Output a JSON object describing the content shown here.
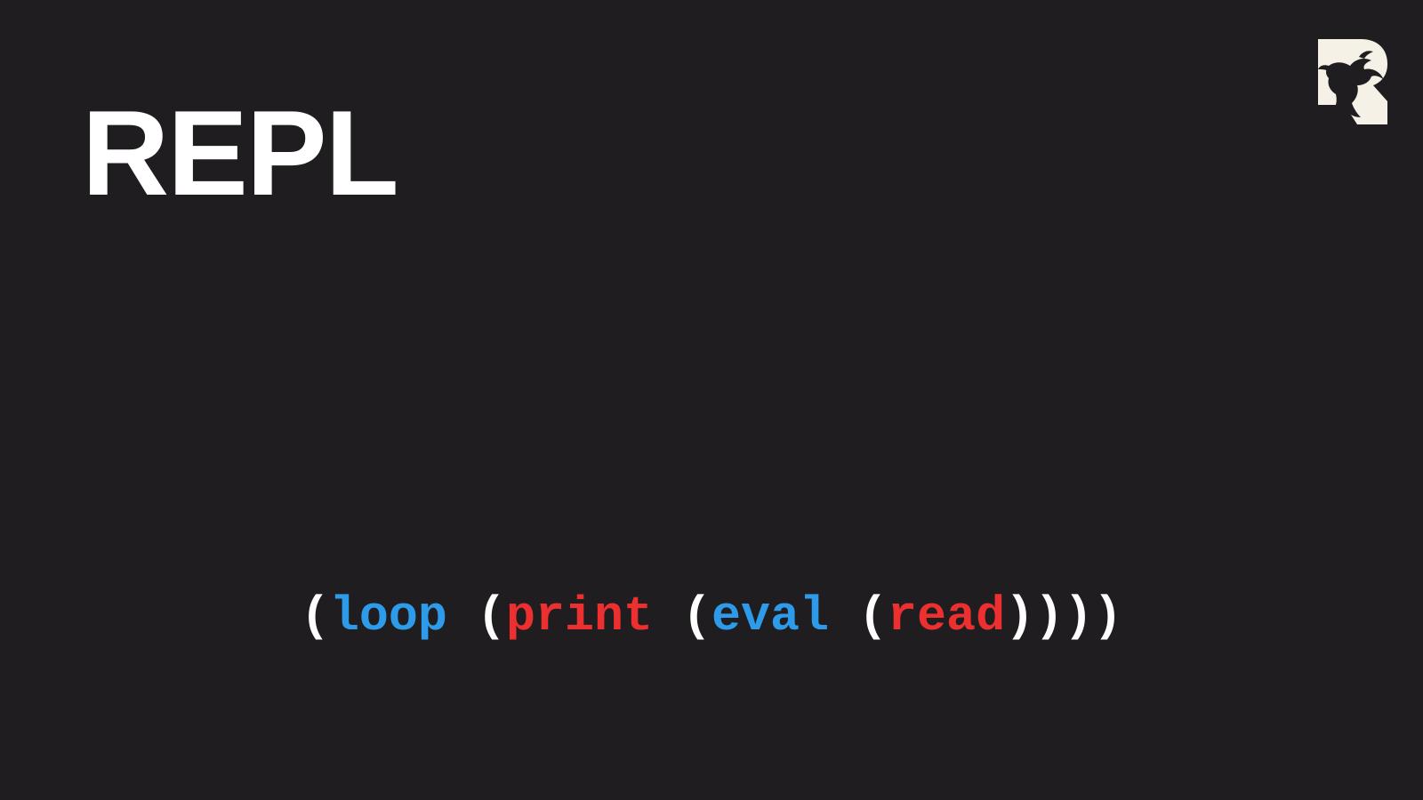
{
  "slide": {
    "title": "REPL",
    "logo": {
      "icon": "bull-r-logo-icon"
    },
    "colors": {
      "background": "#201d20",
      "title": "#ffffff",
      "paren": "#ffffff",
      "blue": "#2e9bea",
      "red": "#ec2f2f",
      "logo_bg": "#f6f1e7"
    },
    "code": {
      "p_open_1": "(",
      "loop": "loop",
      "p_open_2": " (",
      "print": "print",
      "p_open_3": " (",
      "eval": "eval",
      "p_open_4": " (",
      "read": "read",
      "p_close": "))))"
    }
  }
}
